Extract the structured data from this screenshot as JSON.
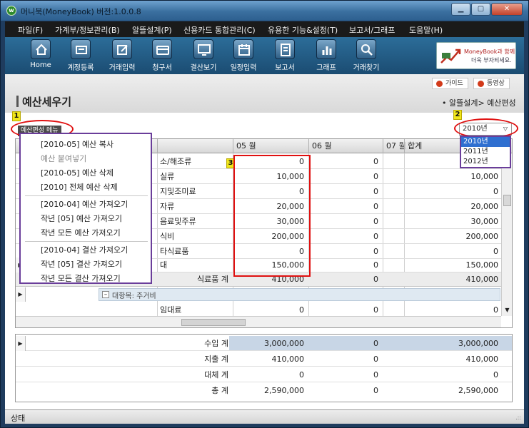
{
  "window": {
    "title": "머니북(MoneyBook) 버전:1.0.0.8",
    "app_icon_letter": "w",
    "min_glyph": "▁",
    "max_glyph": "▢",
    "close_glyph": "✕"
  },
  "menu": [
    "파일(F)",
    "가계부/정보관리(B)",
    "알뜰설계(P)",
    "신용카드 통합관리(C)",
    "유용한 기능&설정(T)",
    "보고서/그래프",
    "도움말(H)"
  ],
  "toolbar": [
    {
      "label": "Home",
      "icon": "home-icon"
    },
    {
      "label": "계정등록",
      "icon": "account-icon"
    },
    {
      "label": "거래입력",
      "icon": "edit-icon"
    },
    {
      "label": "청구서",
      "icon": "card-icon"
    },
    {
      "label": "결산보기",
      "icon": "monitor-icon"
    },
    {
      "label": "일정입력",
      "icon": "calendar-icon"
    },
    {
      "label": "보고서",
      "icon": "report-icon"
    },
    {
      "label": "그래프",
      "icon": "graph-icon"
    },
    {
      "label": "거래찾기",
      "icon": "search-icon"
    }
  ],
  "banner": {
    "line1": "MoneyBook과 함께",
    "line2": "더욱 부자되세요."
  },
  "links": {
    "guide": "가이드",
    "video": "동영상"
  },
  "page": {
    "title": "예산세우기",
    "breadcrumb": "• 알뜰설계> 예산편성"
  },
  "markers": [
    "1",
    "2",
    "3"
  ],
  "budget_menu": {
    "button_label": "예산편성 메뉴",
    "items": [
      {
        "label": "[2010-05] 예산 복사",
        "enabled": true
      },
      {
        "label": "예산 붙여넣기",
        "enabled": false
      },
      {
        "label": "[2010-05] 예산 삭제",
        "enabled": true
      },
      {
        "label": "[2010] 전체 예산 삭제",
        "enabled": true
      },
      {
        "label": "[2010-04] 예산 가져오기",
        "enabled": true
      },
      {
        "label": "작년 [05] 예산 가져오기",
        "enabled": true
      },
      {
        "label": "작년 모든 예산 가져오기",
        "enabled": true
      },
      {
        "label": "[2010-04] 결산 가져오기",
        "enabled": true
      },
      {
        "label": "작년 [05] 결산 가져오기",
        "enabled": true
      },
      {
        "label": "작년 모든 결산 가져오기",
        "enabled": true
      }
    ]
  },
  "year_select": {
    "value": "2010년",
    "options": [
      "2010년",
      "2011년",
      "2012년"
    ]
  },
  "grid": {
    "columns": {
      "m05": "05 월",
      "m06": "06 월",
      "m07": "07 월",
      "total": "합계"
    },
    "rows": [
      {
        "name": "소/해조류",
        "m05": "0",
        "m06": "0",
        "total": "0"
      },
      {
        "name": "실류",
        "m05": "10,000",
        "m06": "0",
        "total": "10,000"
      },
      {
        "name": "지및조미료",
        "m05": "0",
        "m06": "0",
        "total": "0"
      },
      {
        "name": "자류",
        "m05": "20,000",
        "m06": "0",
        "total": "20,000"
      },
      {
        "name": "음료및주류",
        "m05": "30,000",
        "m06": "0",
        "total": "30,000"
      },
      {
        "name": "식비",
        "m05": "200,000",
        "m06": "0",
        "total": "200,000"
      },
      {
        "name": "타식료품",
        "m05": "0",
        "m06": "0",
        "total": "0"
      },
      {
        "name": "대",
        "m05": "150,000",
        "m06": "0",
        "total": "150,000"
      }
    ],
    "subtotal": {
      "name": "식료품 계",
      "m05": "410,000",
      "m06": "0",
      "total": "410,000"
    },
    "category": {
      "toggle": "–",
      "label": "대항목: 주거비"
    },
    "last_row": {
      "name": "임대료",
      "m05": "0",
      "m06": "0",
      "total": "0"
    }
  },
  "summary": [
    {
      "label": "수입 계",
      "m05": "3,000,000",
      "m06": "0",
      "total": "3,000,000"
    },
    {
      "label": "지출 계",
      "m05": "410,000",
      "m06": "0",
      "total": "410,000"
    },
    {
      "label": "대체 계",
      "m05": "0",
      "m06": "0",
      "total": "0"
    },
    {
      "label": "총 계",
      "m05": "2,590,000",
      "m06": "0",
      "total": "2,590,000"
    }
  ],
  "status": {
    "text": "상태",
    "grip": ".::"
  },
  "glyphs": {
    "row_arrow": "▶",
    "dropdown": "▽",
    "scroll_down": "▼"
  }
}
